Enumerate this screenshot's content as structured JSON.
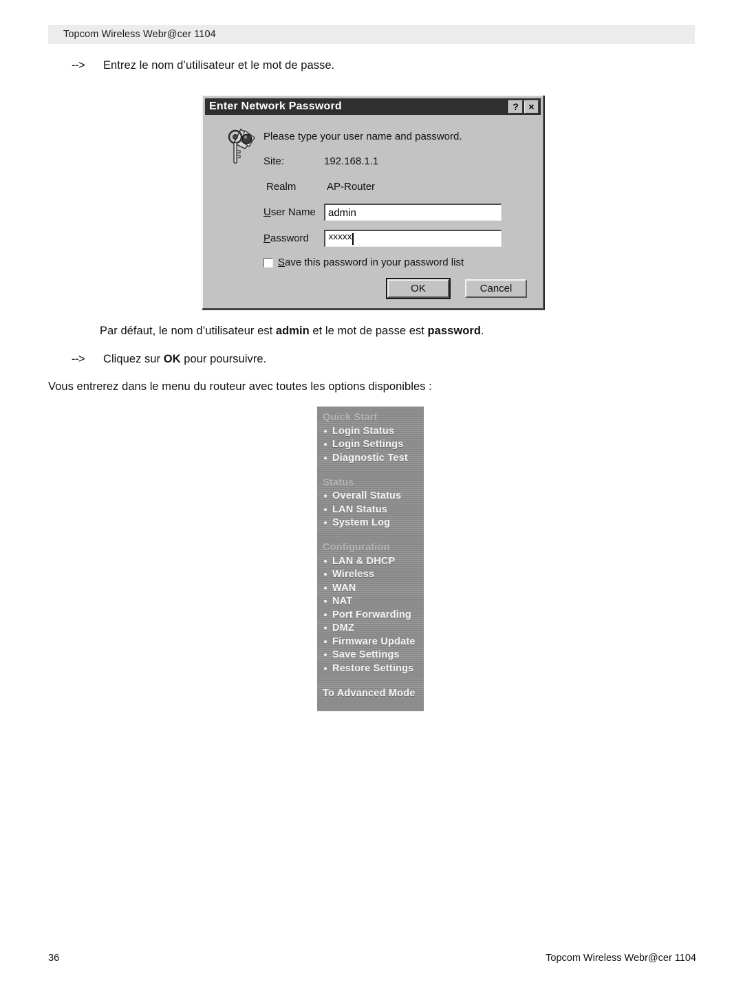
{
  "page": {
    "header_title": "Topcom Wireless Webr@cer 1104",
    "footer_page_number": "36",
    "footer_title": "Topcom Wireless Webr@cer 1104"
  },
  "instructions": {
    "arrow_marker": "-->",
    "enter_credentials": "Entrez le nom d’utilisateur et le mot de passe.",
    "default_creds_pre": "Par défaut, le nom d’utilisateur est ",
    "default_creds_user": "admin",
    "default_creds_mid": " et le mot de passe est ",
    "default_creds_pass": "password",
    "default_creds_end": ".",
    "click_ok_pre": "Cliquez sur ",
    "click_ok_bold": "OK",
    "click_ok_post": " pour poursuivre.",
    "router_menu_intro": "Vous entrerez dans le menu du routeur avec toutes les options disponibles :"
  },
  "dialog": {
    "title": "Enter Network Password",
    "help_button": "?",
    "close_button": "×",
    "prompt": "Please type your user name and password.",
    "site_label": "Site:",
    "site_value": "192.168.1.1",
    "realm_label": "Realm",
    "realm_value": "AP-Router",
    "username_label_underlined": "U",
    "username_label_rest": "ser Name",
    "username_value": "admin",
    "password_label_underlined": "P",
    "password_label_rest": "assword",
    "password_value": "xxxxx",
    "save_checkbox_underlined": "S",
    "save_checkbox_rest": "ave this password in your password list",
    "save_checkbox_checked": false,
    "ok_button": "OK",
    "cancel_button": "Cancel"
  },
  "router_menu": {
    "sections": [
      {
        "title": "Quick Start",
        "items": [
          "Login Status",
          "Login Settings",
          "Diagnostic Test"
        ]
      },
      {
        "title": "Status",
        "items": [
          "Overall Status",
          "LAN Status",
          "System Log"
        ]
      },
      {
        "title": "Configuration",
        "items": [
          "LAN & DHCP",
          "Wireless",
          "WAN",
          "NAT",
          "Port Forwarding",
          "DMZ",
          "Firmware Update",
          "Save Settings",
          "Restore Settings"
        ]
      }
    ],
    "footer_link": "To Advanced Mode"
  },
  "colors": {
    "header_band": "#ececec",
    "dialog_face": "#c3c3c3",
    "titlebar": "#2f2f2f",
    "menu_panel": "#8e8e8e",
    "menu_section_title": "#b5b5b5",
    "menu_item_text": "#f5f5f5"
  }
}
